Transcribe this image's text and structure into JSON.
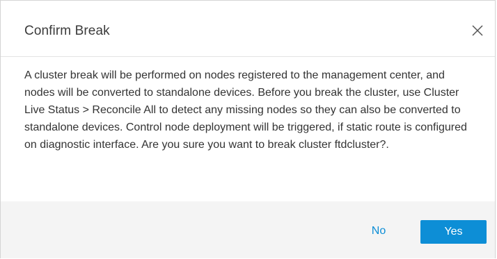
{
  "dialog": {
    "title": "Confirm Break",
    "close_icon": "close-icon",
    "message": "A cluster break will be performed on nodes registered to the management center, and nodes will be converted to standalone devices. Before you break the cluster, use Cluster Live Status > Reconcile All to detect any missing nodes so they can also be converted to standalone devices. Control node deployment will be triggered, if static route is configured on diagnostic interface. Are you sure you want to break cluster ftdcluster?.",
    "buttons": {
      "no_label": "No",
      "yes_label": "Yes"
    }
  },
  "colors": {
    "accent": "#0d8ed6",
    "footer_bg": "#f4f4f4",
    "text": "#333333"
  }
}
